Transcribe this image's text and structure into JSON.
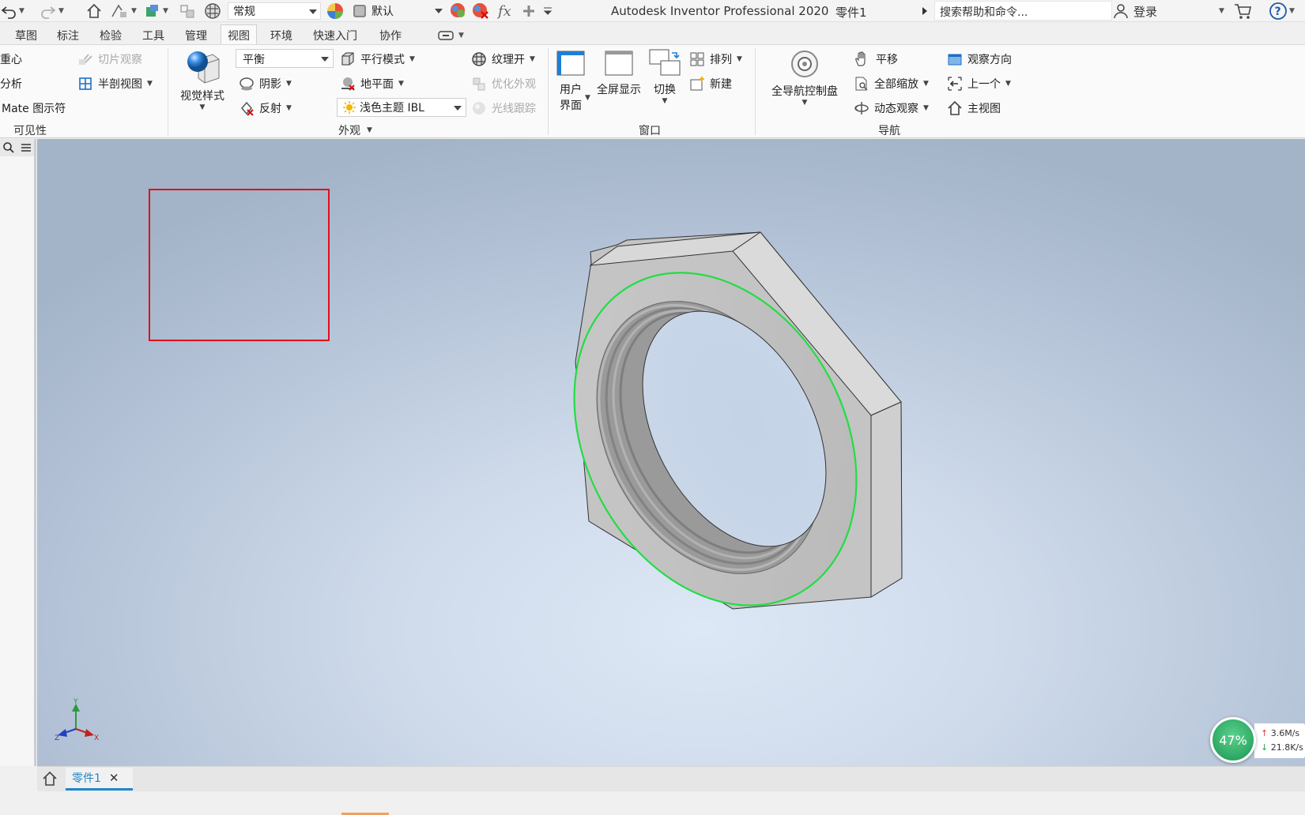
{
  "titlebar": {
    "style_combo": "常规",
    "appearance_combo": "默认",
    "app_title": "Autodesk Inventor Professional 2020",
    "doc_title": "零件1",
    "search_placeholder": "搜索帮助和命令...",
    "login_label": "登录"
  },
  "tabs": [
    "草图",
    "标注",
    "检验",
    "工具",
    "管理",
    "视图",
    "环境",
    "快速入门",
    "协作"
  ],
  "active_tab": "视图",
  "ribbon": {
    "visibility": {
      "center_of_gravity": "重心",
      "analysis": "分析",
      "mate_symbol": "Mate 图示符",
      "slice_view": "切片观察",
      "half_section": "半剖视图",
      "label": "可见性"
    },
    "appearance": {
      "visual_style": "视觉样式",
      "balance_combo": "平衡",
      "shadow": "阴影",
      "reflection": "反射",
      "parallel_mode": "平行模式",
      "ground_plane": "地平面",
      "ibl_combo": "浅色主题 IBL",
      "texture_on": "纹理开",
      "optimize_appearance": "优化外观",
      "ray_tracing": "光线跟踪",
      "label": "外观"
    },
    "window": {
      "user_interface_1": "用户",
      "user_interface_2": "界面",
      "full_screen": "全屏显示",
      "switch": "切换",
      "arrange": "排列",
      "new": "新建",
      "label": "窗口"
    },
    "navigation": {
      "full_nav_wheel": "全导航控制盘",
      "pan": "平移",
      "zoom_all": "全部缩放",
      "orbit": "动态观察",
      "look_at": "观察方向",
      "previous": "上一个",
      "home_view": "主视图",
      "label": "导航"
    }
  },
  "triad": {
    "x": "X",
    "y": "Y",
    "z": "Z"
  },
  "doc_tab": "零件1",
  "net_widget": {
    "percent": "47%",
    "upload": "3.6M/s",
    "download": "21.8K/s"
  },
  "colors": {
    "selection_rect": "#e0101a",
    "edge_highlight": "#22dd44",
    "active_tab_text": "#1f86c8",
    "net_ring": "#2da864"
  }
}
